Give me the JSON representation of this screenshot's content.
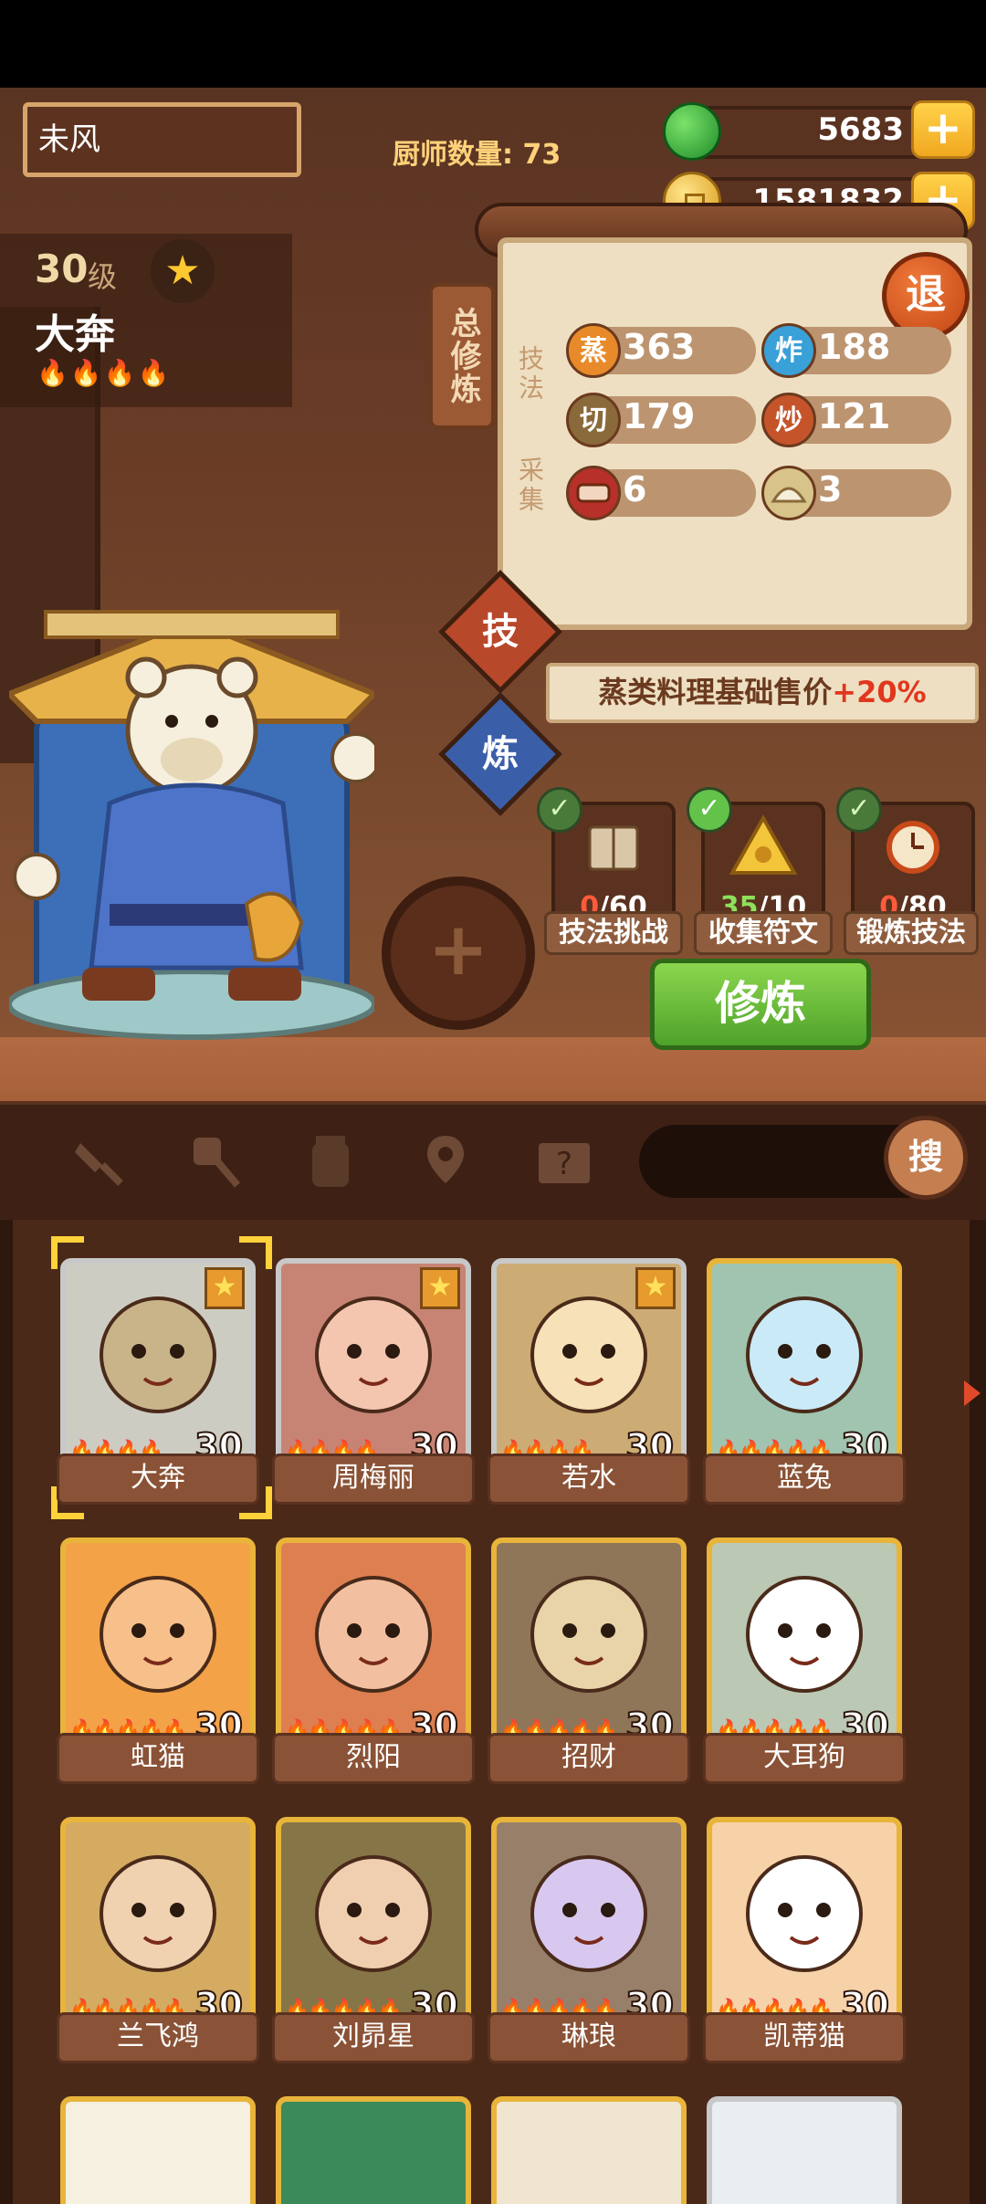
{
  "player": {
    "name": "未风",
    "chef_count_label": "厨师数量: 73"
  },
  "resources": {
    "jade": "5683",
    "coins": "1581832",
    "plus": "+"
  },
  "chef": {
    "level": "30",
    "level_unit": "级",
    "name": "大奔",
    "flames": "🔥🔥🔥🔥",
    "star": "★"
  },
  "panel": {
    "tag": "总修炼",
    "skills_label": "技法",
    "gather_label": "采集",
    "exit": "退",
    "skills": [
      {
        "icon": "蒸",
        "value": "363"
      },
      {
        "icon": "炸",
        "value": "188"
      },
      {
        "icon": "切",
        "value": "179"
      },
      {
        "icon": "炒",
        "value": "121"
      }
    ],
    "gather": [
      {
        "icon": "meat-icon",
        "value": "6"
      },
      {
        "icon": "bun-icon",
        "value": "3"
      }
    ]
  },
  "modes": {
    "skill": "技",
    "refine": "炼"
  },
  "bonus": {
    "text": "蒸类料理基础售价",
    "value": "+20%"
  },
  "tasks": [
    {
      "label": "技法挑战",
      "current": "0",
      "total": "/60",
      "state": "red",
      "icon": "book-icon"
    },
    {
      "label": "收集符文",
      "current": "35",
      "total": "/10",
      "state": "green",
      "icon": "rune-icon"
    },
    {
      "label": "锻炼技法",
      "current": "0",
      "total": "/80",
      "state": "red",
      "icon": "alarm-icon"
    }
  ],
  "train_button": "修炼",
  "search": {
    "button": "搜",
    "placeholder": ""
  },
  "chefs": [
    {
      "name": "大奔",
      "level": "30",
      "flames": "🔥🔥🔥🔥",
      "frame": "silver",
      "fav": true
    },
    {
      "name": "周梅丽",
      "level": "30",
      "flames": "🔥🔥🔥🔥",
      "frame": "silver",
      "fav": true
    },
    {
      "name": "若水",
      "level": "30",
      "flames": "🔥🔥🔥🔥",
      "frame": "silver",
      "fav": true
    },
    {
      "name": "蓝兔",
      "level": "30",
      "flames": "🔥🔥🔥🔥🔥",
      "frame": "gold",
      "fav": false
    },
    {
      "name": "虹猫",
      "level": "30",
      "flames": "🔥🔥🔥🔥🔥",
      "frame": "gold",
      "fav": false
    },
    {
      "name": "烈阳",
      "level": "30",
      "flames": "🔥🔥🔥🔥🔥",
      "frame": "gold",
      "fav": false
    },
    {
      "name": "招财",
      "level": "30",
      "flames": "🔥🔥🔥🔥🔥",
      "frame": "gold",
      "fav": false
    },
    {
      "name": "大耳狗",
      "level": "30",
      "flames": "🔥🔥🔥🔥🔥",
      "frame": "gold",
      "fav": false
    },
    {
      "name": "兰飞鸿",
      "level": "30",
      "flames": "🔥🔥🔥🔥🔥",
      "frame": "gold",
      "fav": false
    },
    {
      "name": "刘昴星",
      "level": "30",
      "flames": "🔥🔥🔥🔥🔥",
      "frame": "gold",
      "fav": false
    },
    {
      "name": "琳琅",
      "level": "30",
      "flames": "🔥🔥🔥🔥🔥",
      "frame": "gold",
      "fav": false
    },
    {
      "name": "凯蒂猫",
      "level": "30",
      "flames": "🔥🔥🔥🔥🔥",
      "frame": "gold",
      "fav": false
    }
  ],
  "colors": {
    "gold_frame": "#e8b43a",
    "silver_frame": "#c8c8c8",
    "accent_red": "#e0371d",
    "green_button": "#4ea22a"
  }
}
